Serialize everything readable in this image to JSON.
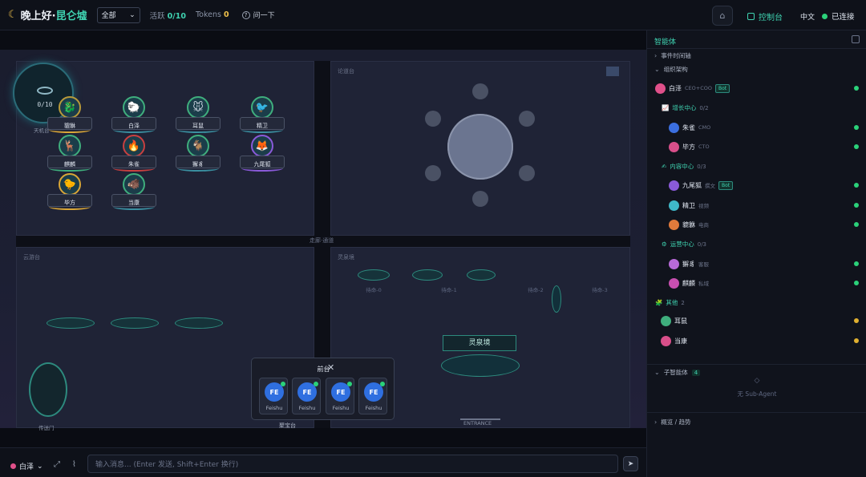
{
  "header": {
    "greeting": "晚上好·",
    "user": "昆仑墟",
    "filter": "全部",
    "active_label": "活跃",
    "active_value": "0/10",
    "tokens_label": "Tokens",
    "tokens_value": "0",
    "ask": "问一下",
    "console": "控制台",
    "lang": "中文",
    "status": "已连接"
  },
  "map": {
    "hud_count": "0/10",
    "hud_label": "天机台",
    "rooms": {
      "forum": "论道台",
      "cloud": "云游台",
      "spring": "灵泉境",
      "portal": "传送门",
      "treasure": "聚宝台",
      "entrance": "ENTRANCE",
      "spring_box": "灵泉境"
    },
    "agents": [
      "貔貅",
      "白泽",
      "耳鼠",
      "精卫",
      "麒麟",
      "朱雀",
      "獬豸",
      "九尾狐",
      "毕方",
      "当康"
    ],
    "slots": [
      "待命-0",
      "待命-1",
      "待命-2",
      "待命-3"
    ],
    "corridor": "走廊·通道"
  },
  "front_desk": {
    "title": "前台",
    "cards": [
      {
        "avatar": "FE",
        "label": "Feishu"
      },
      {
        "avatar": "FE",
        "label": "Feishu"
      },
      {
        "avatar": "FE",
        "label": "Feishu"
      },
      {
        "avatar": "FE",
        "label": "Feishu"
      }
    ]
  },
  "composer": {
    "agent": "白泽",
    "placeholder": "输入消息... (Enter 发送, Shift+Enter 换行)"
  },
  "sidebar": {
    "title": "智能体",
    "timeline": "事件时间轴",
    "org": "组织架构",
    "ceo": {
      "name": "白泽",
      "role": "CEO+COO",
      "badge": "Bot"
    },
    "groups": [
      {
        "name": "增长中心",
        "count": "0/2",
        "members": [
          {
            "name": "朱雀",
            "role": "CMO",
            "color": "#3b6fe0"
          },
          {
            "name": "毕方",
            "role": "CTO",
            "color": "#d94f8a"
          }
        ]
      },
      {
        "name": "内容中心",
        "count": "0/3",
        "members": [
          {
            "name": "九尾狐",
            "role": "撰文",
            "badge": "Bot",
            "color": "#8a5ad9"
          },
          {
            "name": "精卫",
            "role": "视频",
            "color": "#3fb8c8"
          },
          {
            "name": "貔貅",
            "role": "电商",
            "color": "#e07a3b"
          }
        ]
      },
      {
        "name": "运营中心",
        "count": "0/3",
        "members": [
          {
            "name": "獬豸",
            "role": "客服",
            "color": "#b86ad9"
          },
          {
            "name": "麒麟",
            "role": "私域",
            "color": "#c84fb0"
          }
        ]
      }
    ],
    "other": {
      "name": "其他",
      "count": "2",
      "members": [
        {
          "name": "耳鼠",
          "color": "#3fae7d"
        },
        {
          "name": "当康",
          "color": "#d94f8a"
        }
      ]
    },
    "sub_agents": "子智能体",
    "sub_count": "4",
    "no_sub": "无 Sub-Agent",
    "overview": "概览 / 趋势"
  },
  "colors": {
    "accent": "#3fd3b1",
    "online": "#2bd27a",
    "idle": "#e0b030"
  }
}
